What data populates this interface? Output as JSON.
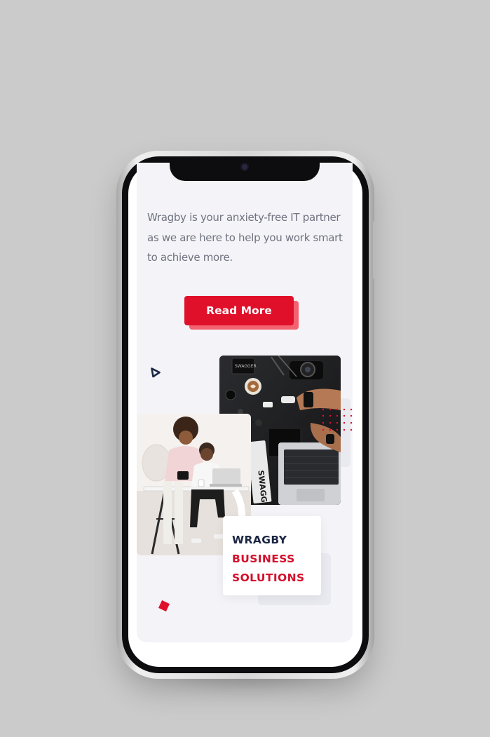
{
  "content": {
    "intro_text": "Wragby is your anxiety-free IT partner as we are here to help you work smart to achieve more.",
    "read_more_label": "Read More"
  },
  "brand": {
    "line1": "WRAGBY",
    "line2": "BUSINESS",
    "line3": "SOLUTIONS"
  },
  "colors": {
    "accent_red": "#e0102a",
    "navy": "#1c2744",
    "text_gray": "#6f7380",
    "card_bg": "#f4f3f7",
    "page_bg": "#cbcbcb"
  },
  "icons": {
    "triangle": "outline-triangle-icon",
    "diamond": "red-diamond-icon",
    "dots": "dot-grid-pattern"
  }
}
